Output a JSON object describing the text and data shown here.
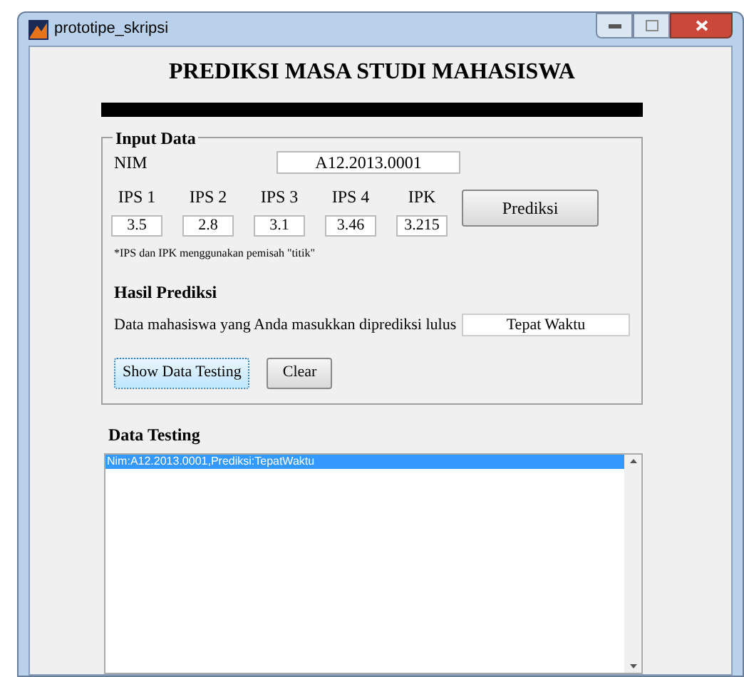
{
  "window": {
    "title": "prototipe_skripsi"
  },
  "heading": "PREDIKSI MASA STUDI MAHASISWA",
  "input_panel": {
    "title": "Input Data",
    "nim_label": "NIM",
    "nim_value": "A12.2013.0001",
    "scores": [
      {
        "label": "IPS 1",
        "value": "3.5"
      },
      {
        "label": "IPS 2",
        "value": "2.8"
      },
      {
        "label": "IPS 3",
        "value": "3.1"
      },
      {
        "label": "IPS 4",
        "value": "3.46"
      },
      {
        "label": "IPK",
        "value": "3.215"
      }
    ],
    "predict_button": "Prediksi",
    "note": "*IPS dan IPK menggunakan pemisah \"titik\"",
    "result_heading": "Hasil Prediksi",
    "result_label": "Data mahasiswa yang Anda masukkan diprediksi lulus",
    "result_value": "Tepat Waktu",
    "buttons": [
      {
        "label": "Show Data Testing",
        "focused": true
      },
      {
        "label": "Clear",
        "focused": false
      }
    ]
  },
  "data_testing": {
    "title": "Data Testing",
    "items": [
      {
        "text": "Nim:A12.2013.0001,Prediksi:TepatWaktu",
        "selected": true
      }
    ]
  }
}
